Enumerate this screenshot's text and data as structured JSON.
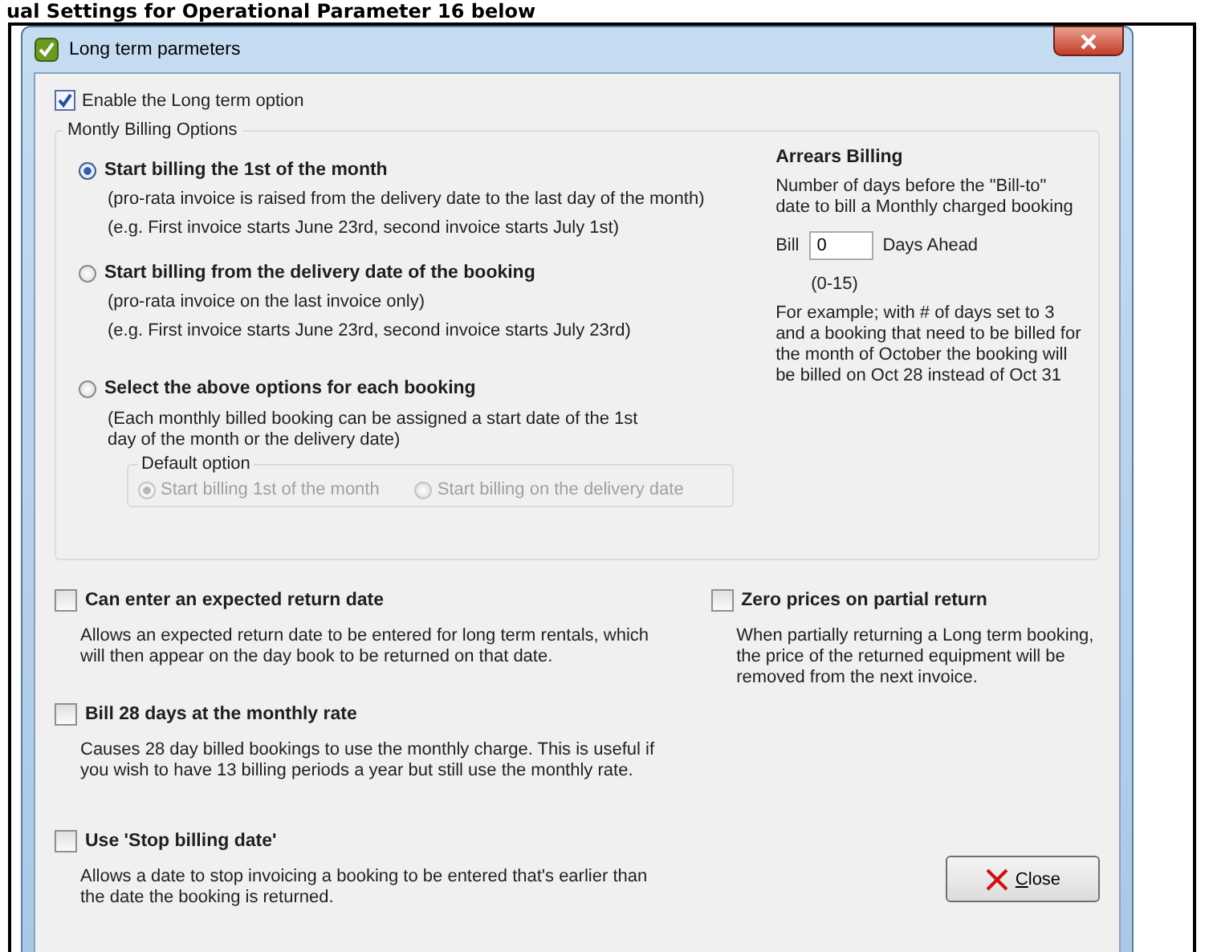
{
  "heading": "ual Settings for Operational Parameter 16 below",
  "window": {
    "title": "Long term parmeters"
  },
  "enable_option": {
    "label": "Enable the Long term option",
    "checked": true
  },
  "billing_group": {
    "title": "Montly Billing Options",
    "options": [
      {
        "label": "Start billing the 1st of the month",
        "selected": true,
        "notes": [
          "(pro-rata invoice is raised from the delivery date  to the last day of the month)",
          "(e.g. First invoice starts June 23rd, second invoice starts July 1st)"
        ]
      },
      {
        "label": "Start billing from the delivery date of the booking",
        "selected": false,
        "notes": [
          "(pro-rata invoice on the last invoice only)",
          "(e.g. First invoice starts June 23rd, second invoice starts July 23rd)"
        ]
      },
      {
        "label": "Select the above options for each booking",
        "selected": false,
        "notes": [
          "(Each monthly billed booking can be assigned a start date of the 1st day of the month or the delivery date)"
        ]
      }
    ],
    "default_option": {
      "title": "Default option",
      "disabled": true,
      "choices": [
        {
          "label": "Start billing 1st of the month",
          "selected": true
        },
        {
          "label": "Start billing on the delivery date",
          "selected": false
        }
      ]
    }
  },
  "arrears": {
    "title": "Arrears Billing",
    "description": "Number of days before the \"Bill-to\" date to bill a Monthly charged booking",
    "bill_label": "Bill",
    "value": "0",
    "suffix": "Days Ahead",
    "range": "(0-15)",
    "example": "For example; with # of days set to 3 and a booking that need to be billed for the month of October the booking will be billed on Oct 28 instead of Oct 31"
  },
  "settings_left": [
    {
      "label": "Can enter an expected return date",
      "checked": false,
      "description": "Allows an expected return date to be entered for long term rentals, which will then appear on the day book to be returned on that date."
    },
    {
      "label": "Bill 28 days at the monthly rate",
      "checked": false,
      "description": "Causes 28 day billed bookings to use the monthly charge. This is useful if you wish to have 13 billing periods a year but still use the monthly rate."
    },
    {
      "label": "Use 'Stop billing date'",
      "checked": false,
      "description": "Allows a date to stop invoicing a booking to be entered that's earlier than the date the booking is returned."
    }
  ],
  "settings_right": [
    {
      "label": "Zero prices on partial return",
      "checked": false,
      "description": "When partially returning a Long term booking, the price of the returned equipment will be removed from the next invoice."
    }
  ],
  "close_button": "Close"
}
